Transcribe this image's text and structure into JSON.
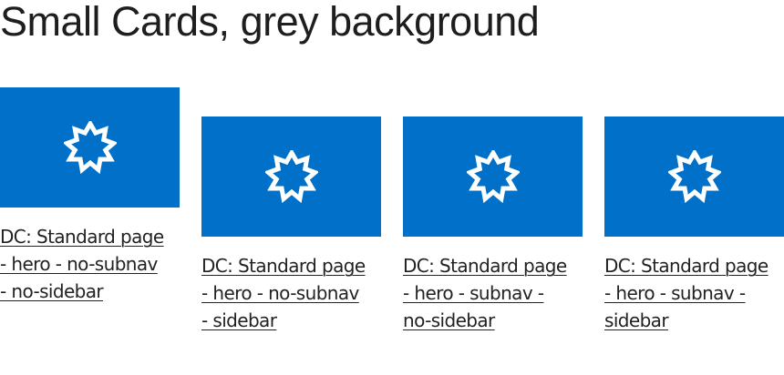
{
  "section": {
    "title": "Small Cards, grey background"
  },
  "theme": {
    "card_image_color": "#0070c8",
    "icon_color": "#ffffff",
    "text_color": "#222222"
  },
  "cards": [
    {
      "icon": "nine-point-star-icon",
      "title": "DC: Standard page - hero - no-subnav - no-sidebar"
    },
    {
      "icon": "nine-point-star-icon",
      "title": "DC: Standard page - hero - no-subnav - sidebar"
    },
    {
      "icon": "nine-point-star-icon",
      "title": "DC: Standard page - hero - subnav - no-sidebar"
    },
    {
      "icon": "nine-point-star-icon",
      "title": "DC: Standard page - hero - subnav - sidebar"
    }
  ]
}
